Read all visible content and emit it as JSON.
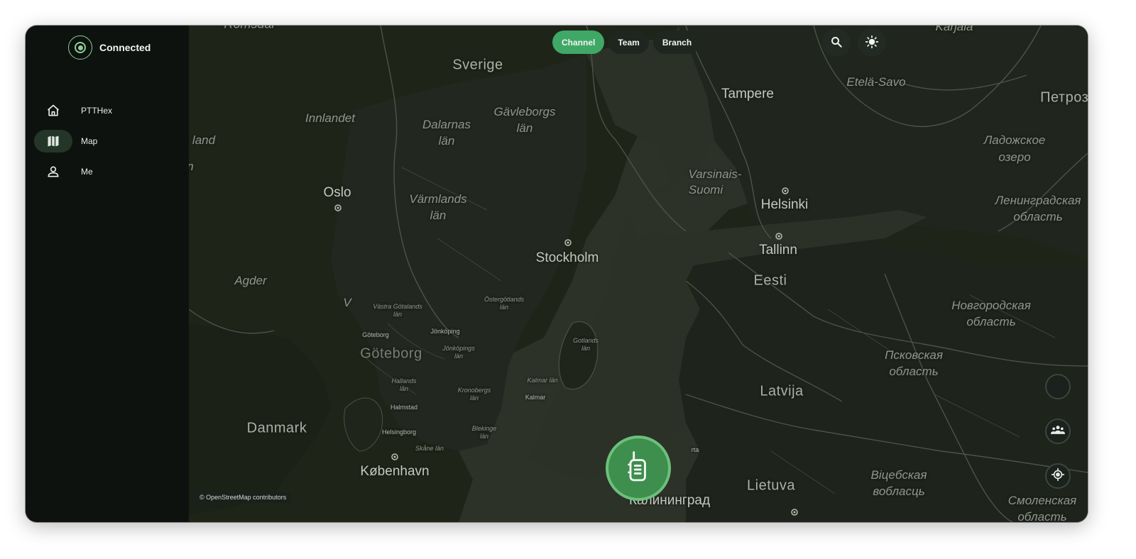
{
  "status": {
    "label": "Connected",
    "color": "#8fcf95",
    "icon": "connection-icon"
  },
  "nav": {
    "items": [
      {
        "label": "PTTHex",
        "icon": "home-icon",
        "active": false
      },
      {
        "label": "Map",
        "icon": "map-icon",
        "active": true
      },
      {
        "label": "Me",
        "icon": "person-icon",
        "active": false
      }
    ]
  },
  "tabs": [
    {
      "label": "Channel",
      "active": true
    },
    {
      "label": "Team",
      "active": false
    },
    {
      "label": "Branch",
      "active": false
    }
  ],
  "toolbar": {
    "search_icon": "search-icon",
    "theme_icon": "sun-icon"
  },
  "map": {
    "attribution": "© OpenStreetMap contributors",
    "accent": "#3fa866",
    "labels": {
      "sverige": "Sverige",
      "tampere": "Tampere",
      "etela_savo": "Etelä-Savo",
      "petroza": "Петроза",
      "innlandet": "Innlandet",
      "dalarnas": "Dalarnas",
      "dalarnas_lan": "län",
      "gavleborgs": "Gävleborgs",
      "gavleborgs_lan": "län",
      "ladozhskoe": "Ладожское",
      "ozero": "озеро",
      "land": "land",
      "n": "n",
      "varsinais": "Varsinais-",
      "suomi": "Suomi",
      "oslo": "Oslo",
      "varmlands": "Värmlands",
      "varmlands_lan": "län",
      "helsinki": "Helsinki",
      "leningradskaya": "Ленинградская",
      "oblast_1": "область",
      "stockholm": "Stockholm",
      "tallinn": "Tallinn",
      "agder": "Agder",
      "eesti": "Eesti",
      "v": "V",
      "vastra_gotalands": "Västra Götalands",
      "vastra_lan": "län",
      "ostergotlands": "Östergötlands",
      "ostergotlands_lan": "län",
      "novgorodskaya": "Новгородская",
      "oblast_2": "область",
      "goteborg_city": "Göteborg",
      "jonkoping": "Jönköping",
      "jonkopings": "Jönköpings",
      "jonkopings_lan": "län",
      "gotlands": "Gotlands",
      "gotlands_lan": "län",
      "pskovskaya": "Псковская",
      "oblast_3": "область",
      "goteborg_big": "Göteborg",
      "hallands": "Hallands",
      "hallands_lan": "län",
      "kronobergs": "Kronobergs",
      "kronobergs_lan": "län",
      "kalmar_lan_1": "Kalmar län",
      "kalmar": "Kalmar",
      "latvija": "Latvija",
      "halmstad": "Halmstad",
      "danmark": "Danmark",
      "helsingborg": "Helsingborg",
      "blekinge": "Blekinge",
      "blekinge_lan": "län",
      "skane_lan": "Skåne län",
      "kobenhavn": "København",
      "vitsebskaya": "Віцебская",
      "voblasts": "вобласць",
      "lietuva": "Lietuva",
      "kaliningrad": "Калининград",
      "smolenskaya": "Смоленская",
      "oblast_4": "область",
      "rta": "rta",
      "karjala": "Karjala",
      "romsdal": "Romsdal"
    }
  },
  "fabs": [
    {
      "icon": "empty-circle-icon"
    },
    {
      "icon": "group-icon"
    },
    {
      "icon": "my-location-icon"
    }
  ],
  "ptt": {
    "icon": "walkie-talkie-icon"
  }
}
